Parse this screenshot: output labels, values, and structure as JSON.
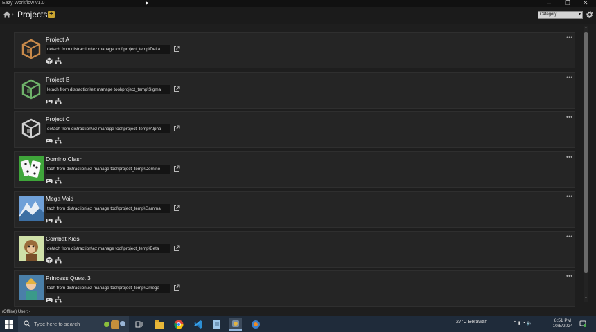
{
  "window": {
    "title": "Eazy Workflow v1.0",
    "controls": {
      "minimize": "–",
      "maximize": "❐",
      "close": "✕"
    }
  },
  "header": {
    "breadcrumb_sep": "›",
    "title": "Projects",
    "add_label": "+",
    "category": {
      "value": "Category",
      "caret": "▾"
    }
  },
  "projects": [
    {
      "name": "Project A",
      "path": "detach from distraction\\ez manage tool\\project_temp\\Delta",
      "thumb": "box-icon",
      "thumb_color": "#c98a4a",
      "type": "unity"
    },
    {
      "name": "Project B",
      "path": "letach from distraction\\ez manage tool\\project_temp\\Sigma",
      "thumb": "box-icon",
      "thumb_color": "#6fb36a",
      "type": "gamepad"
    },
    {
      "name": "Project C",
      "path": "detach from distraction\\ez manage tool\\project_temp\\Alpha",
      "thumb": "box-icon",
      "thumb_color": "#d0d0d0",
      "type": "gamepad"
    },
    {
      "name": "Domino Clash",
      "path": "tach from distraction\\ez manage tool\\project_temp\\Domino",
      "thumb": "domino-thumb",
      "thumb_color": "#3fa53a",
      "type": "gamepad"
    },
    {
      "name": "Mega Void",
      "path": "tach from distraction\\ez manage tool\\project_temp\\Gamma",
      "thumb": "mountain-thumb",
      "thumb_color": "#6fa0d8",
      "type": "gamepad"
    },
    {
      "name": "Combat Kids",
      "path": "detach from distraction\\ez manage tool\\project_temp\\Beta",
      "thumb": "monkey-thumb",
      "thumb_color": "#9a6b3a",
      "type": "unity"
    },
    {
      "name": "Princess Quest 3",
      "path": "tach from distraction\\ez manage tool\\project_temp\\Omega",
      "thumb": "princess-thumb",
      "thumb_color": "#4a7fa8",
      "type": "gamepad"
    }
  ],
  "more_label": "•••",
  "status": {
    "text": "(Offline) User: -"
  },
  "taskbar": {
    "search_placeholder": "Type here to search",
    "weather": "27°C  Berawan",
    "tray": "⌃  ▮  ◔  🔈",
    "time": "8:51 PM",
    "date": "10/5/2024"
  }
}
